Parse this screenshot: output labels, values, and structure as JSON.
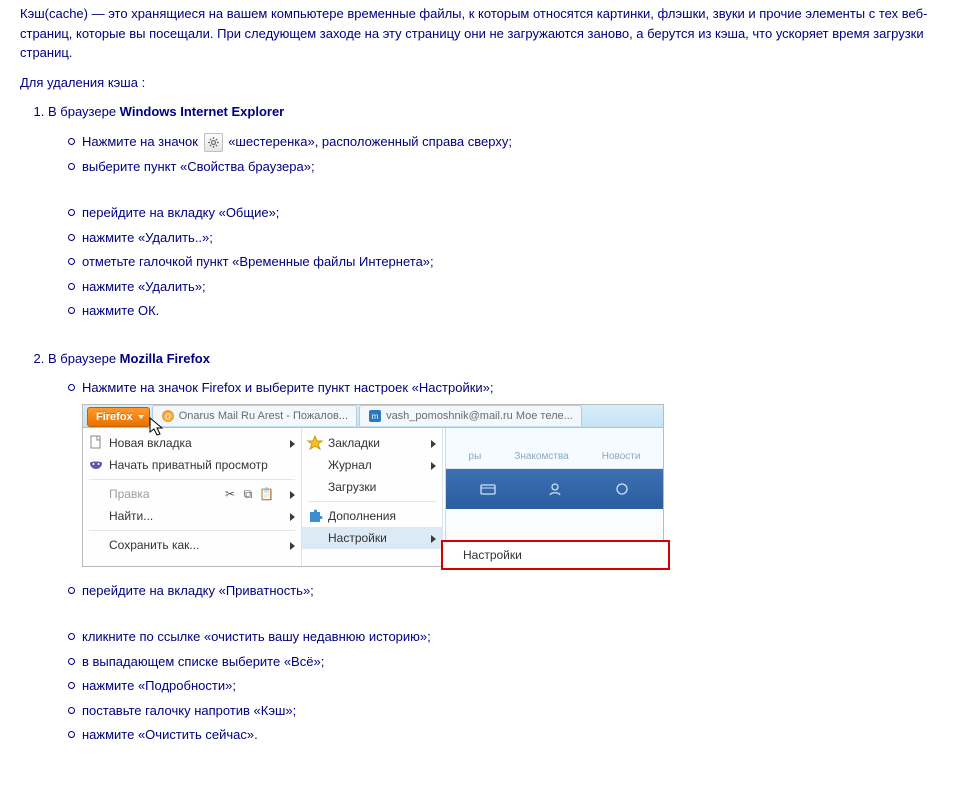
{
  "intro": {
    "p1": "Кэш(cache) — это хранящиеся на вашем компьютере временные файлы, к которым относятся картинки, флэшки, звуки и прочие элементы с тех веб-страниц, которые вы посещали. При следующем заходе на эту страницу они не загружаются заново, а берутся из кэша, что ускоряет время загрузки страниц.",
    "p2": "Для удаления кэша :"
  },
  "steps": [
    {
      "prefix": "В браузере ",
      "bold": "Windows Internet Explorer",
      "sub": [
        {
          "pre": "Нажмите на значок ",
          "has_gear": true,
          "post": " «шестеренка», расположенный справа сверху;"
        },
        {
          "text": "выберите пункт «Свойства браузера»;"
        },
        {
          "spacer": true
        },
        {
          "text": "перейдите на вкладку «Общие»;"
        },
        {
          "text": "нажмите «Удалить..»;"
        },
        {
          "text": "отметьте галочкой пункт «Временные файлы Интернета»;"
        },
        {
          "text": "нажмите «Удалить»;"
        },
        {
          "text": "нажмите ОК."
        }
      ]
    },
    {
      "prefix": "В браузере ",
      "bold": "Mozilla Firefox",
      "sub": [
        {
          "text": "Нажмите на значок Firefox и выберите пункт настроек «Настройки»;"
        },
        {
          "screenshot": true
        },
        {
          "text": "перейдите на вкладку «Приватность»;"
        },
        {
          "spacer": true
        },
        {
          "text": "кликните по ссылке «очистить вашу недавнюю историю»;"
        },
        {
          "text": "в выпадающем списке выберите «Всё»;"
        },
        {
          "text": "нажмите «Подробности»;"
        },
        {
          "text": "поставьте галочку напротив «Кэш»;"
        },
        {
          "text": "нажмите «Очистить сейчас»."
        }
      ]
    }
  ],
  "ff": {
    "button": "Firefox",
    "tab1": "Onarus Mail Ru Arest - Пожалов...",
    "tab2": "vash_pomoshnik@mail.ru Мое теле...",
    "col1": [
      {
        "label": "Новая вкладка",
        "arrow": true,
        "icon": "doc"
      },
      {
        "label": "Начать приватный просмотр",
        "icon": "mask"
      },
      {
        "sep": true
      },
      {
        "label": "Правка",
        "disabled": true,
        "tools": true,
        "arrow": true
      },
      {
        "label": "Найти...",
        "arrow": true
      },
      {
        "sep": true
      },
      {
        "label": "Сохранить как...",
        "arrow": true
      }
    ],
    "col2": [
      {
        "label": "Закладки",
        "arrow": true,
        "icon": "star"
      },
      {
        "label": "Журнал",
        "arrow": true
      },
      {
        "label": "Загрузки"
      },
      {
        "sep": true
      },
      {
        "label": "Дополнения",
        "icon": "puzzle"
      },
      {
        "label": "Настройки",
        "arrow": true,
        "hover": true
      }
    ],
    "submenu": "Настройки",
    "right_tabs": [
      "ры",
      "Знакомства",
      "Новости"
    ]
  }
}
